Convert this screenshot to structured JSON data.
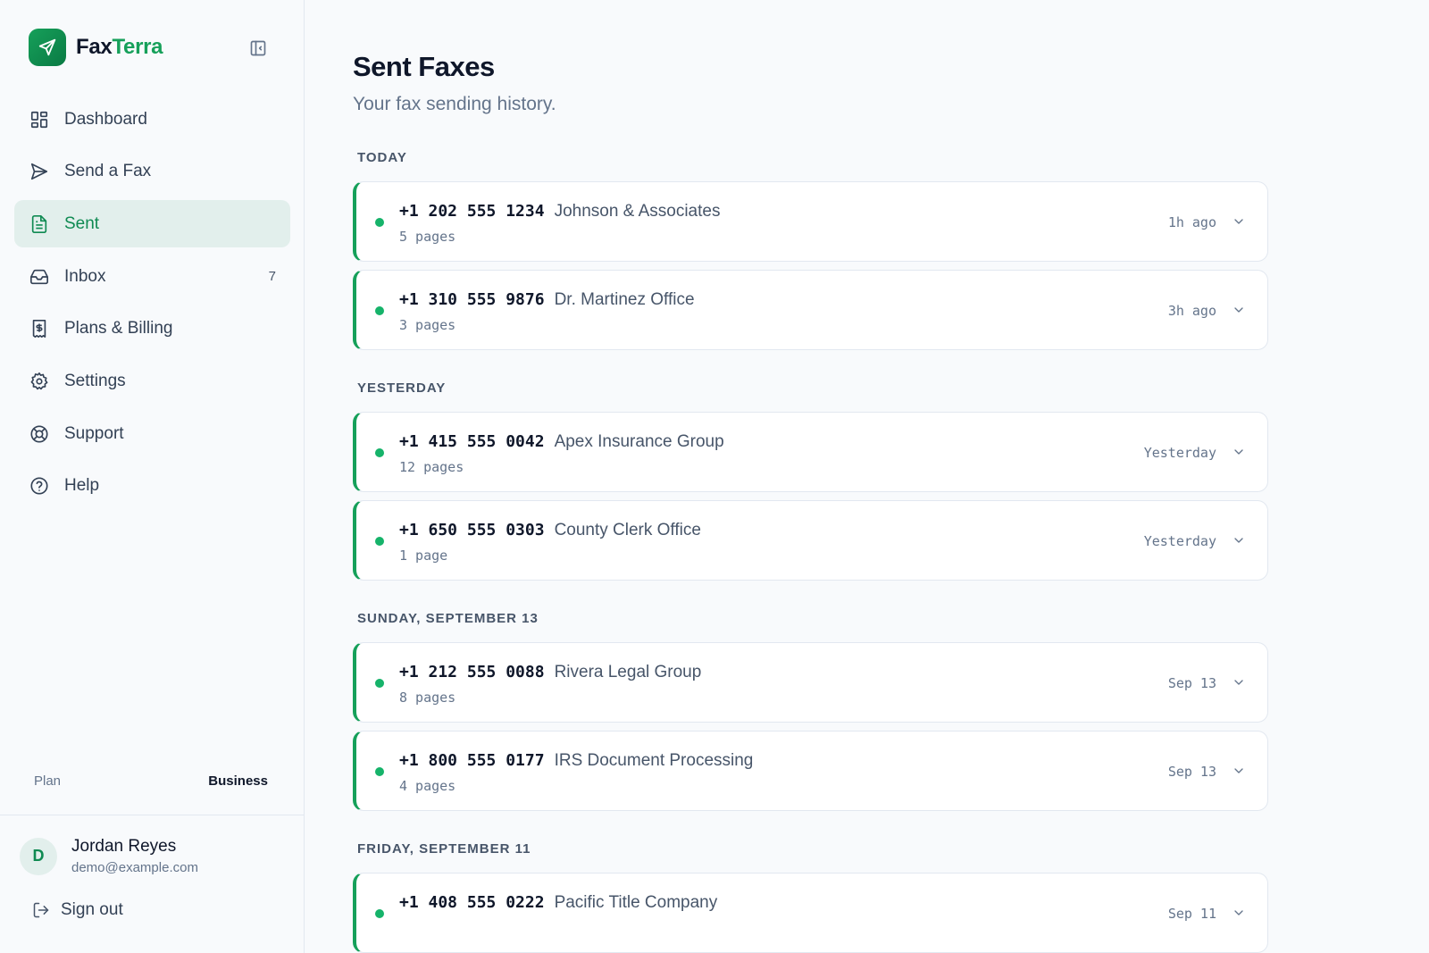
{
  "brand": {
    "name_part1": "Fax",
    "name_part2": "Terra",
    "logo_icon": "paper-plane-icon",
    "accent": "#16a05a"
  },
  "sidebar": {
    "collapse_icon": "sidebar-collapse-icon",
    "items": [
      {
        "label": "Dashboard",
        "icon": "grid-icon",
        "active": false,
        "count": ""
      },
      {
        "label": "Send a Fax",
        "icon": "send-icon",
        "active": false,
        "count": ""
      },
      {
        "label": "Sent",
        "icon": "document-icon",
        "active": true,
        "count": ""
      },
      {
        "label": "Inbox",
        "icon": "inbox-icon",
        "active": false,
        "count": "7"
      },
      {
        "label": "Plans & Billing",
        "icon": "billing-icon",
        "active": false,
        "count": ""
      },
      {
        "label": "Settings",
        "icon": "gear-icon",
        "active": false,
        "count": ""
      },
      {
        "label": "Support",
        "icon": "lifebuoy-icon",
        "active": false,
        "count": ""
      },
      {
        "label": "Help",
        "icon": "help-icon",
        "active": false,
        "count": ""
      }
    ],
    "plan": {
      "label": "Plan",
      "value": "Business"
    },
    "user": {
      "initial": "D",
      "name": "Jordan Reyes",
      "email": "demo@example.com"
    },
    "signout_label": "Sign out"
  },
  "main": {
    "title": "Sent Faxes",
    "subtitle": "Your fax sending history.",
    "groups": [
      {
        "label": "TODAY",
        "faxes": [
          {
            "number": "+1 202 555 1234",
            "recipient": "Johnson & Associates",
            "pages": "5 pages",
            "time": "1h ago"
          },
          {
            "number": "+1 310 555 9876",
            "recipient": "Dr. Martinez Office",
            "pages": "3 pages",
            "time": "3h ago"
          }
        ]
      },
      {
        "label": "YESTERDAY",
        "faxes": [
          {
            "number": "+1 415 555 0042",
            "recipient": "Apex Insurance Group",
            "pages": "12 pages",
            "time": "Yesterday"
          },
          {
            "number": "+1 650 555 0303",
            "recipient": "County Clerk Office",
            "pages": "1 page",
            "time": "Yesterday"
          }
        ]
      },
      {
        "label": "SUNDAY, SEPTEMBER 13",
        "faxes": [
          {
            "number": "+1 212 555 0088",
            "recipient": "Rivera Legal Group",
            "pages": "8 pages",
            "time": "Sep 13"
          },
          {
            "number": "+1 800 555 0177",
            "recipient": "IRS Document Processing",
            "pages": "4 pages",
            "time": "Sep 13"
          }
        ]
      },
      {
        "label": "FRIDAY, SEPTEMBER 11",
        "faxes": [
          {
            "number": "+1 408 555 0222",
            "recipient": "Pacific Title Company",
            "pages": "",
            "time": "Sep 11"
          }
        ]
      }
    ]
  }
}
